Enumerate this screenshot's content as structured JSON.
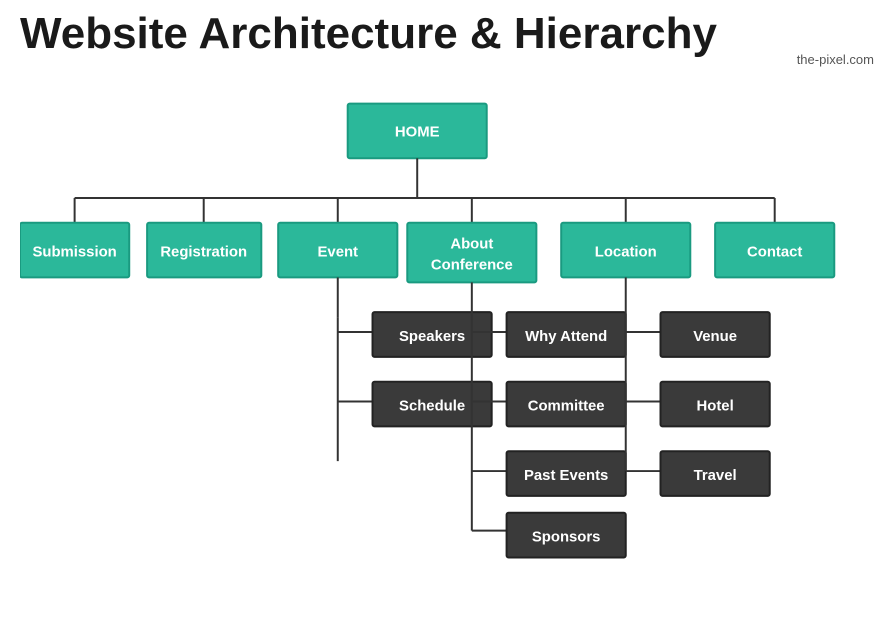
{
  "title": "Website Architecture & Hierarchy",
  "brand": "the-pixel.com",
  "nodes": {
    "home": {
      "label": "HOME"
    },
    "level1": [
      {
        "label": "Submission"
      },
      {
        "label": "Registration"
      },
      {
        "label": "Event"
      },
      {
        "label": "About\nConference"
      },
      {
        "label": "Location"
      },
      {
        "label": "Contact"
      }
    ],
    "event_children": [
      "Speakers",
      "Schedule"
    ],
    "about_children": [
      "Why Attend",
      "Committee",
      "Past Events",
      "Sponsors"
    ],
    "location_children": [
      "Venue",
      "Hotel",
      "Travel"
    ]
  }
}
